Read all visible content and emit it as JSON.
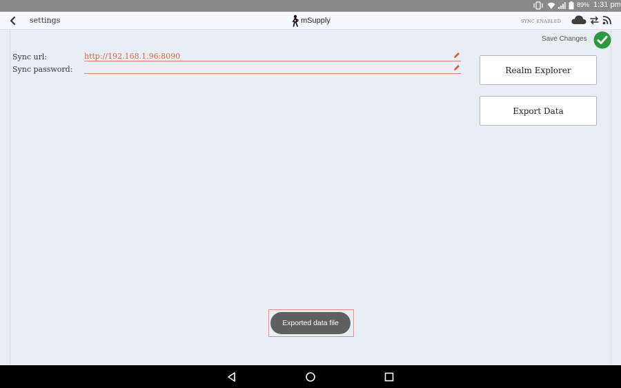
{
  "status_bar": {
    "battery_percent": "89%",
    "time": "1:31 pm",
    "icons": [
      "vibrate-icon",
      "wifi-icon",
      "signal-icon",
      "battery-icon"
    ]
  },
  "header": {
    "back_icon": "chevron-left-icon",
    "title": "settings",
    "logo_text": "mSupply",
    "sync_status": "SYNC ENABLED",
    "icons": [
      "cloud-icon",
      "sync-arrows-icon",
      "rss-feed-icon"
    ]
  },
  "actions": {
    "save_label": "Save Changes",
    "save_icon": "checkmark-icon",
    "save_color": "#2e9a3e"
  },
  "form": {
    "sync_url": {
      "label": "Sync url:",
      "value": "http://192.168.1.96:8090"
    },
    "sync_password": {
      "label": "Sync password:",
      "value": ""
    },
    "accent_color": "#d0643f"
  },
  "buttons": {
    "realm_explorer": "Realm Explorer",
    "export_data": "Export Data"
  },
  "toast": {
    "message": "Exported data file"
  },
  "nav_bar": {
    "icons": [
      "back-triangle-icon",
      "home-circle-icon",
      "recents-square-icon"
    ]
  }
}
